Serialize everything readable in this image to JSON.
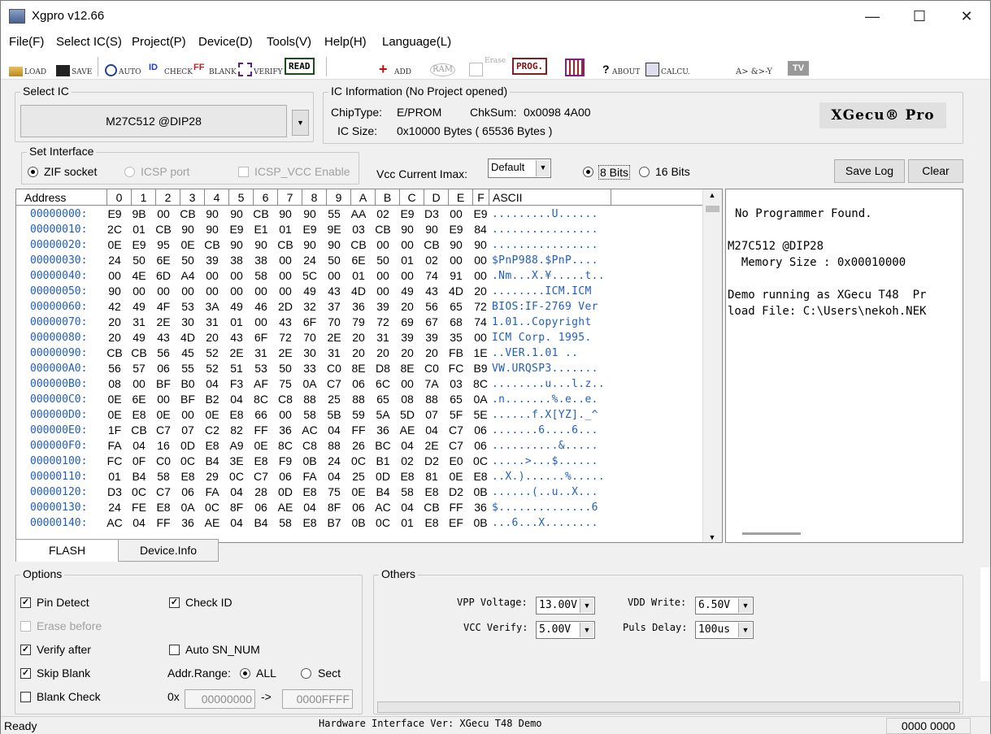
{
  "window": {
    "title": "Xgpro v12.66"
  },
  "menu": [
    "File(F)",
    "Select IC(S)",
    "Project(P)",
    "Device(D)",
    "Tools(V)",
    "Help(H)",
    "Language(L)"
  ],
  "toolbar": {
    "load": "LOAD",
    "save": "SAVE",
    "auto": "AUTO",
    "check": "CHECK",
    "blank": "BLANK",
    "verify": "VERIFY",
    "read": "READ",
    "add": "ADD",
    "ram": "RAM",
    "erase": "Erase",
    "prog": "PROG.",
    "about": "ABOUT",
    "calcu": "CALCU.",
    "logic": "A> &>-Y",
    "tv": "TV"
  },
  "select_ic": {
    "label": "Select IC",
    "value": "M27C512 @DIP28"
  },
  "ic_info": {
    "label": "IC Information (No Project opened)",
    "chiptype_label": "ChipType:",
    "chiptype": "E/PROM",
    "chksum_label": "ChkSum:",
    "chksum": "0x0098 4A00",
    "size_label": "IC Size:",
    "size": "0x10000 Bytes ( 65536 Bytes )",
    "logo": "XGecu® Pro"
  },
  "interface": {
    "label": "Set Interface",
    "zif": "ZIF socket",
    "icsp": "ICSP port",
    "icsp_vcc": "ICSP_VCC Enable"
  },
  "vcc_imax": {
    "label": "Vcc Current Imax:",
    "value": "Default"
  },
  "bits": {
    "b8": "8 Bits",
    "b16": "16 Bits"
  },
  "buttons": {
    "save_log": "Save Log",
    "clear": "Clear"
  },
  "hex": {
    "headers": [
      "Address",
      "0",
      "1",
      "2",
      "3",
      "4",
      "5",
      "6",
      "7",
      "8",
      "9",
      "A",
      "B",
      "C",
      "D",
      "E",
      "F",
      "ASCII"
    ],
    "rows": [
      [
        "00000000:",
        "E9 9B 00 CB 90 90 CB 90 90 55 AA 02 E9 D3 00 E9",
        ".........U......"
      ],
      [
        "00000010:",
        "2C 01 CB 90 90 E9 E1 01 E9 9E 03 CB 90 90 E9 84",
        "................"
      ],
      [
        "00000020:",
        "0E E9 95 0E CB 90 90 CB 90 90 CB 00 00 CB 90 90",
        "................"
      ],
      [
        "00000030:",
        "24 50 6E 50 39 38 38 00 24 50 6E 50 01 02 00 00",
        "$PnP988.$PnP...."
      ],
      [
        "00000040:",
        "00 4E 6D A4 00 00 58 00 5C 00 01 00 00 74 91 00",
        ".Nm...X.¥.....t.."
      ],
      [
        "00000050:",
        "90 00 00 00 00 00 00 00 49 43 4D 00 49 43 4D 20",
        "........ICM.ICM "
      ],
      [
        "00000060:",
        "42 49 4F 53 3A 49 46 2D 32 37 36 39 20 56 65 72",
        "BIOS:IF-2769 Ver"
      ],
      [
        "00000070:",
        "20 31 2E 30 31 01 00 43 6F 70 79 72 69 67 68 74",
        " 1.01..Copyright"
      ],
      [
        "00000080:",
        "20 49 43 4D 20 43 6F 72 70 2E 20 31 39 39 35 00",
        " ICM Corp. 1995."
      ],
      [
        "00000090:",
        "CB CB 56 45 52 2E 31 2E 30 31 20 20 20 20 FB 1E",
        "..VER.1.01    .."
      ],
      [
        "000000A0:",
        "56 57 06 55 52 51 53 50 33 C0 8E D8 8E C0 FC B9",
        "VW.URQSP3......."
      ],
      [
        "000000B0:",
        "08 00 BF B0 04 F3 AF 75 0A C7 06 6C 00 7A 03 8C",
        "........u...l.z.."
      ],
      [
        "000000C0:",
        "0E 6E 00 BF B2 04 8C C8 88 25 88 65 08 88 65 0A",
        ".n.......%.e..e."
      ],
      [
        "000000D0:",
        "0E E8 0E 00 0E E8 66 00 58 5B 59 5A 5D 07 5F 5E",
        "......f.X[YZ]._^"
      ],
      [
        "000000E0:",
        "1F CB C7 07 C2 82 FF 36 AC 04 FF 36 AE 04 C7 06",
        ".......6....6..."
      ],
      [
        "000000F0:",
        "FA 04 16 0D E8 A9 0E 8C C8 88 26 BC 04 2E C7 06",
        "..........&....."
      ],
      [
        "00000100:",
        "FC 0F C0 0C B4 3E E8 F9 0B 24 0C B1 02 D2 E0 0C",
        ".....>...$......"
      ],
      [
        "00000110:",
        "01 B4 58 E8 29 0C C7 06 FA 04 25 0D E8 81 0E E8",
        "..X.)......%....."
      ],
      [
        "00000120:",
        "D3 0C C7 06 FA 04 28 0D E8 75 0E B4 58 E8 D2 0B",
        "......(..u..X..."
      ],
      [
        "00000130:",
        "24 FE E8 0A 0C 8F 06 AE 04 8F 06 AC 04 CB FF 36",
        "$..............6"
      ],
      [
        "00000140:",
        "AC 04 FF 36 AE 04 B4 58 E8 B7 0B 0C 01 E8 EF 0B",
        "...6...X........"
      ]
    ]
  },
  "log": {
    "lines": [
      "No Programmer Found.",
      "",
      "M27C512 @DIP28",
      "  Memory Size : 0x00010000",
      "",
      "Demo running as XGecu T48  Pr",
      "load File: C:\\Users\\nekoh.NEK"
    ]
  },
  "tabs": {
    "flash": "FLASH",
    "device_info": "Device.Info"
  },
  "options": {
    "label": "Options",
    "pin_detect": "Pin Detect",
    "check_id": "Check ID",
    "erase_before": "Erase before",
    "verify_after": "Verify after",
    "auto_sn": "Auto SN_NUM",
    "skip_blank": "Skip Blank",
    "addr_range": "Addr.Range:",
    "all": "ALL",
    "sect": "Sect",
    "blank_check": "Blank Check",
    "ox": "0x",
    "arrow": "->",
    "addr_from": "00000000",
    "addr_to": "0000FFFF"
  },
  "others": {
    "label": "Others",
    "vpp_label": "VPP Voltage:",
    "vpp": "13.00V",
    "vdd_label": "VDD Write:",
    "vdd": "6.50V",
    "vcc_label": "VCC Verify:",
    "vcc": "5.00V",
    "puls_label": "Puls Delay:",
    "puls": "100us"
  },
  "status": {
    "left": "Ready",
    "center": "Hardware Interface Ver: XGecu T48 Demo",
    "right": "0000 0000"
  }
}
